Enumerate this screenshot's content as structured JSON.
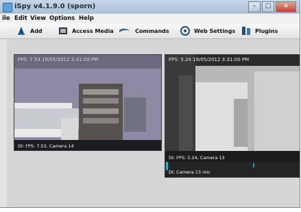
{
  "window": {
    "title": "iSpy v4.1.9.0 (sporn)"
  },
  "menu": [
    "ile",
    "Edit",
    "View",
    "Options",
    "Help"
  ],
  "toolbar": {
    "add": "Add",
    "access_media": "Access Media",
    "commands": "Commands",
    "web_settings": "Web Settings",
    "plugins": "Plugins"
  },
  "cameras": [
    {
      "overlay": "FPS: 7.53 19/05/2012 3:31:00 PM",
      "footer": "DI: FPS: 7.53, Camera 14"
    },
    {
      "overlay": "FPS: 5.24 19/05/2012 3:31:00 PM",
      "footer": "DI: FPS: 5.24, Camera 13",
      "mic": "DI: Camera 13 mic"
    }
  ]
}
